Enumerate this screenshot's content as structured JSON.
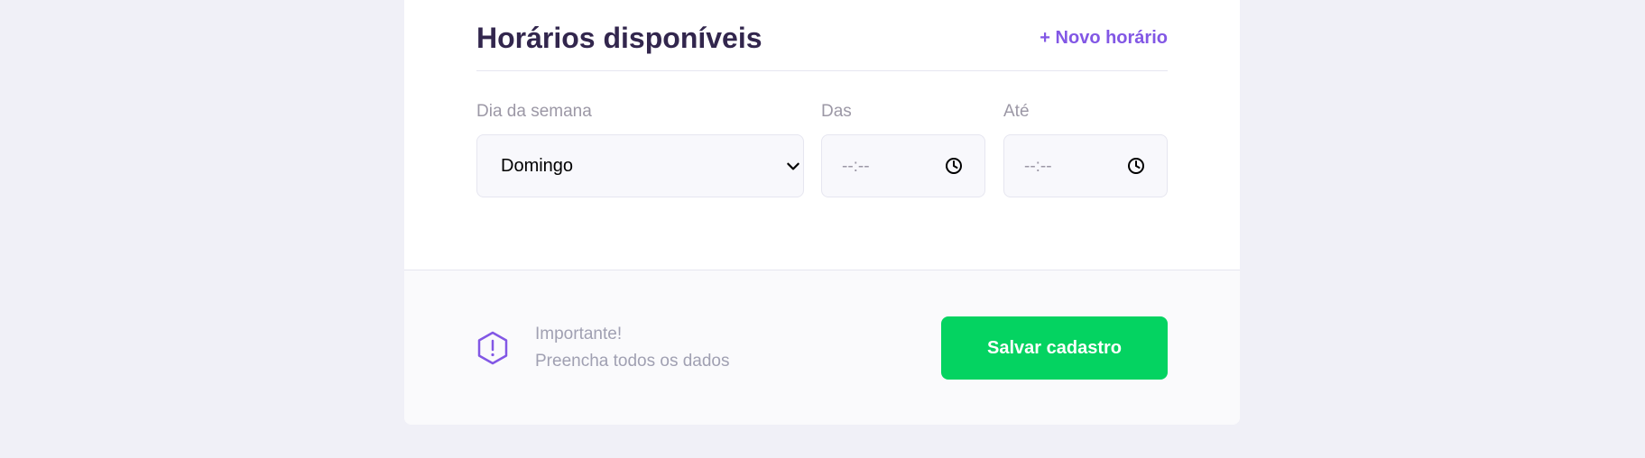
{
  "section": {
    "title": "Horários disponíveis",
    "add_link": "+ Novo horário"
  },
  "schedule_item": {
    "week_day_label": "Dia da semana",
    "week_day_value": "Domingo",
    "from_label": "Das",
    "from_placeholder": "--:--",
    "to_label": "Até",
    "to_placeholder": "--:--"
  },
  "footer": {
    "warning_title": "Importante!",
    "warning_text": "Preencha todos os dados",
    "save_label": "Salvar cadastro"
  },
  "icons": {
    "chevron": "chevron-down-icon",
    "clock": "clock-icon",
    "warning": "warning-icon"
  },
  "colors": {
    "accent": "#8257e5",
    "title": "#32264d",
    "success": "#04d361",
    "background": "#f0f0f7"
  }
}
